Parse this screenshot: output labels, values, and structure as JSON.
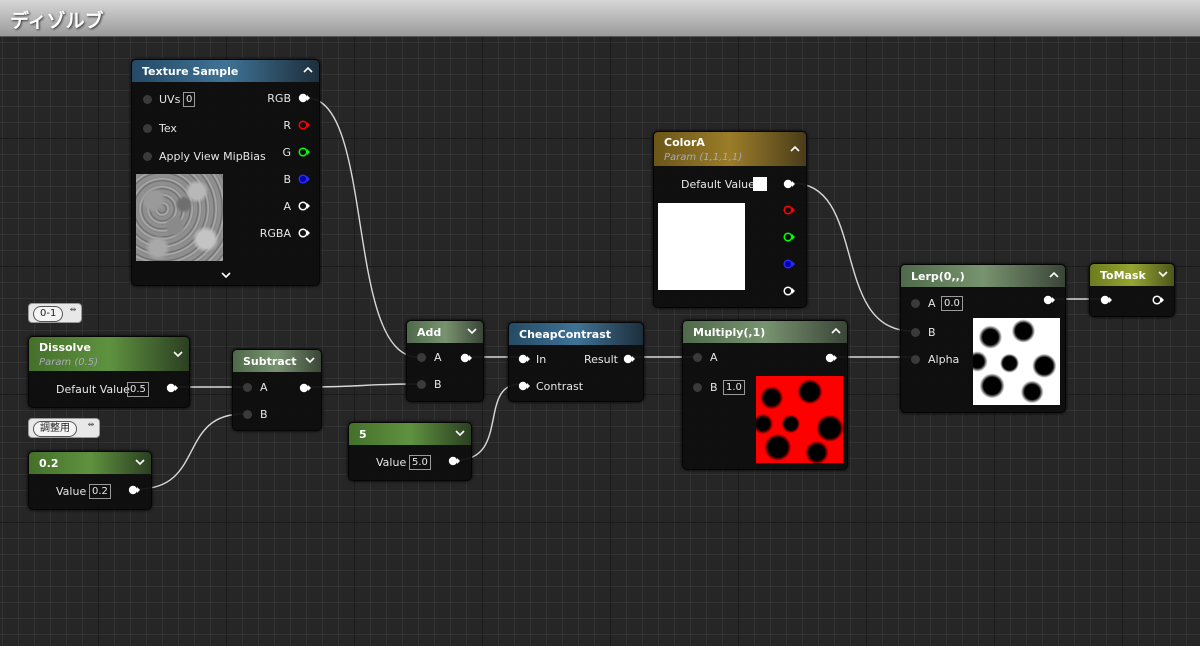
{
  "window": {
    "title": "ディゾルブ"
  },
  "colors": {
    "pin_r": "#ff0000",
    "pin_g": "#00ff00",
    "pin_b": "#2b2bff",
    "pin_white": "#ffffff"
  },
  "comments": {
    "dissolve": "0-1",
    "adjust": "調整用"
  },
  "nodes": {
    "texture_sample": {
      "title": "Texture Sample",
      "inputs": [
        "UVs",
        "Tex",
        "Apply View MipBias"
      ],
      "uvs_value": "0",
      "outputs": [
        "RGB",
        "R",
        "G",
        "B",
        "A",
        "RGBA"
      ]
    },
    "dissolve": {
      "title": "Dissolve",
      "subtitle": "Param (0.5)",
      "field_label": "Default Value",
      "value": "0.5"
    },
    "const_02": {
      "title": "0.2",
      "field_label": "Value",
      "value": "0.2"
    },
    "subtract": {
      "title": "Subtract",
      "inputs": [
        "A",
        "B"
      ]
    },
    "add": {
      "title": "Add",
      "inputs": [
        "A",
        "B"
      ]
    },
    "const_5": {
      "title": "5",
      "field_label": "Value",
      "value": "5.0"
    },
    "cheap_contrast": {
      "title": "CheapContrast",
      "inputs": [
        "In",
        "Contrast"
      ],
      "output": "Result"
    },
    "multiply": {
      "title": "Multiply(,1)",
      "inputs": [
        "A",
        "B"
      ],
      "b_value": "1.0"
    },
    "color_a": {
      "title": "ColorA",
      "subtitle": "Param (1,1,1,1)",
      "field_label": "Default Value"
    },
    "lerp": {
      "title": "Lerp(0,,)",
      "inputs": [
        "A",
        "B",
        "Alpha"
      ],
      "a_value": "0.0"
    },
    "to_mask": {
      "title": "ToMask"
    }
  }
}
